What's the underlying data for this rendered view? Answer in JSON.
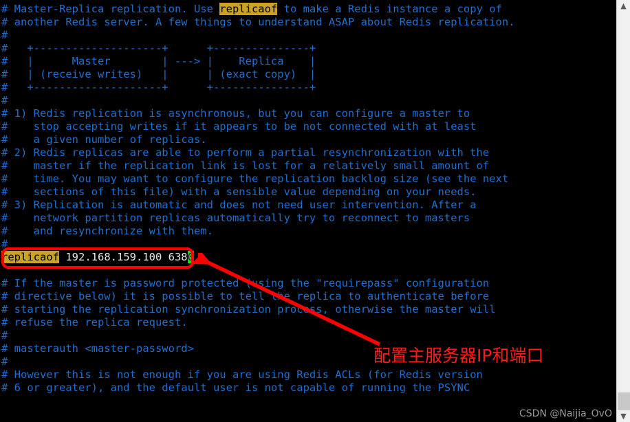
{
  "window": {
    "background": "#000000",
    "comment_color": "#1f6fd0",
    "code_color": "#e8e8e8",
    "search_highlight_bg": "#c9a227",
    "cursor_bg": "#00e800",
    "annotation_color": "#ff1a1a"
  },
  "terminal": {
    "lines": [
      {
        "type": "comment",
        "segments": [
          {
            "text": "# Master-Replica replication. Use "
          },
          {
            "text": "replicaof",
            "style": "search"
          },
          {
            "text": " to make a Redis instance a copy of"
          }
        ]
      },
      {
        "type": "comment",
        "segments": [
          {
            "text": "# another Redis server. A few things to understand ASAP about Redis replication."
          }
        ]
      },
      {
        "type": "comment",
        "segments": [
          {
            "text": "#"
          }
        ]
      },
      {
        "type": "comment",
        "segments": [
          {
            "text": "#   +--------------------+      +---------------+"
          }
        ]
      },
      {
        "type": "comment",
        "segments": [
          {
            "text": "#   |      Master        | ---> |    Replica    |"
          }
        ]
      },
      {
        "type": "comment",
        "segments": [
          {
            "text": "#   | (receive writes)   |      | (exact copy)  |"
          }
        ]
      },
      {
        "type": "comment",
        "segments": [
          {
            "text": "#   +--------------------+      +---------------+"
          }
        ]
      },
      {
        "type": "comment",
        "segments": [
          {
            "text": "#"
          }
        ]
      },
      {
        "type": "comment",
        "segments": [
          {
            "text": "# 1) Redis replication is asynchronous, but you can configure a master to"
          }
        ]
      },
      {
        "type": "comment",
        "segments": [
          {
            "text": "#    stop accepting writes if it appears to be not connected with at least"
          }
        ]
      },
      {
        "type": "comment",
        "segments": [
          {
            "text": "#    a given number of replicas."
          }
        ]
      },
      {
        "type": "comment",
        "segments": [
          {
            "text": "# 2) Redis replicas are able to perform a partial resynchronization with the"
          }
        ]
      },
      {
        "type": "comment",
        "segments": [
          {
            "text": "#    master if the replication link is lost for a relatively small amount of"
          }
        ]
      },
      {
        "type": "comment",
        "segments": [
          {
            "text": "#    time. You may want to configure the replication backlog size (see the next"
          }
        ]
      },
      {
        "type": "comment",
        "segments": [
          {
            "text": "#    sections of this file) with a sensible value depending on your needs."
          }
        ]
      },
      {
        "type": "comment",
        "segments": [
          {
            "text": "# 3) Replication is automatic and does not need user intervention. After a"
          }
        ]
      },
      {
        "type": "comment",
        "segments": [
          {
            "text": "#    network partition replicas automatically try to reconnect to masters"
          }
        ]
      },
      {
        "type": "comment",
        "segments": [
          {
            "text": "#    and resynchronize with them."
          }
        ]
      },
      {
        "type": "comment",
        "segments": [
          {
            "text": "#"
          }
        ]
      },
      {
        "type": "code",
        "segments": [
          {
            "text": "replicaof",
            "style": "search"
          },
          {
            "text": " 192.168.159.100 638"
          },
          {
            "text": "0",
            "style": "cursor"
          }
        ]
      },
      {
        "type": "comment",
        "segments": [
          {
            "text": ""
          }
        ]
      },
      {
        "type": "comment",
        "segments": [
          {
            "text": "# If the master is password protected (using the \"requirepass\" configuration"
          }
        ]
      },
      {
        "type": "comment",
        "segments": [
          {
            "text": "# directive below) it is possible to tell the replica to authenticate before"
          }
        ]
      },
      {
        "type": "comment",
        "segments": [
          {
            "text": "# starting the replication synchronization process, otherwise the master will"
          }
        ]
      },
      {
        "type": "comment",
        "segments": [
          {
            "text": "# refuse the replica request."
          }
        ]
      },
      {
        "type": "comment",
        "segments": [
          {
            "text": "#"
          }
        ]
      },
      {
        "type": "comment",
        "segments": [
          {
            "text": "# masterauth <master-password>"
          }
        ]
      },
      {
        "type": "comment",
        "segments": [
          {
            "text": "#"
          }
        ]
      },
      {
        "type": "comment",
        "segments": [
          {
            "text": "# However this is not enough if you are using Redis ACLs (for Redis version"
          }
        ]
      },
      {
        "type": "comment",
        "segments": [
          {
            "text": "# 6 or greater), and the default user is not capable of running the PSYNC"
          }
        ]
      }
    ]
  },
  "annotation": {
    "text": "配置主服务器IP和端口",
    "arrow": "red-arrow-pointing-up-left"
  },
  "watermark": {
    "text": "CSDN @Naijia_OvO"
  },
  "scrollbar": {
    "up_arrow": "▲",
    "down_arrow": "▼"
  }
}
